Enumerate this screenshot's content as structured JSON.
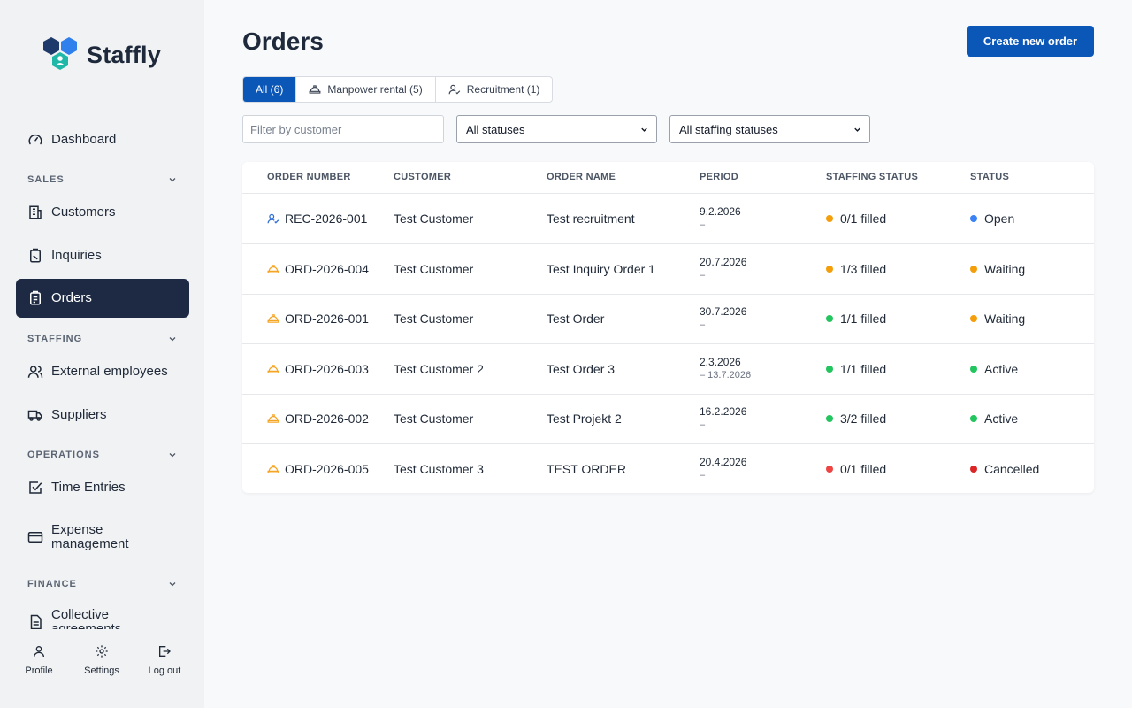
{
  "app": {
    "name": "Staffly"
  },
  "nav": {
    "dashboard": "Dashboard",
    "sections": {
      "sales": "SALES",
      "staffing": "STAFFING",
      "operations": "OPERATIONS",
      "finance": "FINANCE"
    },
    "customers": "Customers",
    "inquiries": "Inquiries",
    "orders": "Orders",
    "external_employees": "External employees",
    "suppliers": "Suppliers",
    "time_entries": "Time Entries",
    "expense_line1": "Expense",
    "expense_line2": "management",
    "collective_line1": "Collective",
    "collective_line2": "agreements"
  },
  "bottom": {
    "profile": "Profile",
    "settings": "Settings",
    "logout": "Log out"
  },
  "page": {
    "title": "Orders",
    "create_button": "Create new order"
  },
  "tabs": {
    "all": "All (6)",
    "manpower": "Manpower rental (5)",
    "recruitment": "Recruitment (1)"
  },
  "filters": {
    "customer_placeholder": "Filter by customer",
    "status": "All statuses",
    "staffing_status": "All staffing statuses"
  },
  "table": {
    "headers": {
      "order_number": "ORDER NUMBER",
      "customer": "CUSTOMER",
      "order_name": "ORDER NAME",
      "period": "PERIOD",
      "staffing_status": "STAFFING STATUS",
      "status": "STATUS"
    },
    "rows": [
      {
        "icon": "person-check-icon",
        "order_number": "REC-2026-001",
        "customer": "Test Customer",
        "order_name": "Test recruitment",
        "period_start": "9.2.2026",
        "period_end": "–",
        "staffing": "0/1 filled",
        "staffing_color": "#f59e0b",
        "status": "Open",
        "status_color": "#3b82f6"
      },
      {
        "icon": "hard-hat-icon",
        "order_number": "ORD-2026-004",
        "customer": "Test Customer",
        "order_name": "Test Inquiry Order 1",
        "period_start": "20.7.2026",
        "period_end": "–",
        "staffing": "1/3 filled",
        "staffing_color": "#f59e0b",
        "status": "Waiting",
        "status_color": "#f59e0b"
      },
      {
        "icon": "hard-hat-icon",
        "order_number": "ORD-2026-001",
        "customer": "Test Customer",
        "order_name": "Test Order",
        "period_start": "30.7.2026",
        "period_end": "–",
        "staffing": "1/1 filled",
        "staffing_color": "#22c55e",
        "status": "Waiting",
        "status_color": "#f59e0b"
      },
      {
        "icon": "hard-hat-icon",
        "order_number": "ORD-2026-003",
        "customer": "Test Customer 2",
        "order_name": "Test Order 3",
        "period_start": "2.3.2026",
        "period_end": "– 13.7.2026",
        "staffing": "1/1 filled",
        "staffing_color": "#22c55e",
        "status": "Active",
        "status_color": "#22c55e"
      },
      {
        "icon": "hard-hat-icon",
        "order_number": "ORD-2026-002",
        "customer": "Test Customer",
        "order_name": "Test Projekt 2",
        "period_start": "16.2.2026",
        "period_end": "–",
        "staffing": "3/2 filled",
        "staffing_color": "#22c55e",
        "status": "Active",
        "status_color": "#22c55e"
      },
      {
        "icon": "hard-hat-icon",
        "order_number": "ORD-2026-005",
        "customer": "Test Customer 3",
        "order_name": "TEST ORDER",
        "period_start": "20.4.2026",
        "period_end": "–",
        "staffing": "0/1 filled",
        "staffing_color": "#ef4444",
        "status": "Cancelled",
        "status_color": "#dc2626"
      }
    ]
  },
  "colors": {
    "primary": "#0b57b8",
    "sidebar_active": "#1e2a44",
    "icon_accent": "#f5a524"
  }
}
